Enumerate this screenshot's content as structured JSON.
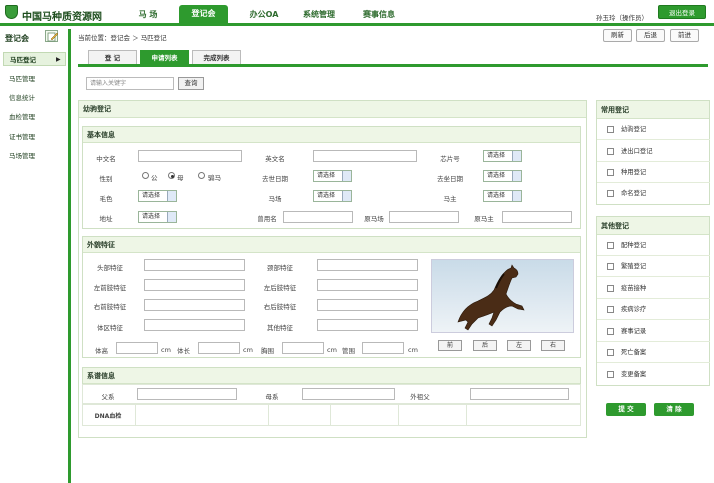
{
  "header": {
    "app_title": "中国马种质资源网",
    "nav": [
      "马 场",
      "登记会",
      "办公OA",
      "系统管理",
      "赛事信息"
    ],
    "user": "孙玉玲（操作员）",
    "logout": "退出登录"
  },
  "sidebar": {
    "title": "登记会",
    "items": [
      {
        "label": "马匹登记"
      },
      {
        "label": "马匹管理"
      },
      {
        "label": "信息统计"
      },
      {
        "label": "血检管理"
      },
      {
        "label": "证书管理"
      },
      {
        "label": "马场管理"
      }
    ]
  },
  "breadcrumb": "当前位置：登记会 ＞ 马匹登记",
  "toolbar": {
    "refresh": "刷新",
    "back": "后退",
    "forward": "前进"
  },
  "tabs": [
    "登 记",
    "申请列表",
    "完成列表"
  ],
  "search": {
    "placeholder": "请输入关键字",
    "button": "查询"
  },
  "form": {
    "title": "幼驹登记",
    "basic": {
      "title": "基本信息",
      "cn_name": "中文名",
      "en_name": "英文名",
      "chip": "芯片号",
      "gender": "性别",
      "gender_options": [
        "公",
        "母",
        "骟马"
      ],
      "death_date": "去世日期",
      "dereg_date": "去坐日期",
      "coat": "毛色",
      "farm": "马场",
      "owner": "马主",
      "address": "地址",
      "former_name": "曾用名",
      "former_farm": "原马场",
      "former_owner": "原马主",
      "select_placeholder": "请选择"
    },
    "appearance": {
      "title": "外貌特征",
      "head": "头部特征",
      "neck": "颈部特征",
      "lf_leg": "左前肢特征",
      "lr_leg": "左后肢特征",
      "rf_leg": "右前肢特征",
      "rr_leg": "右后肢特征",
      "body": "体区特征",
      "other": "其他特征",
      "height": "体高",
      "length": "体长",
      "chest": "胸围",
      "cannon": "管围",
      "unit": "cm",
      "views": [
        "前",
        "后",
        "左",
        "右"
      ]
    },
    "pedigree": {
      "title": "系谱信息",
      "sire": "父系",
      "dam": "母系",
      "grandsire": "外祖父",
      "dna": "DNA血检"
    }
  },
  "right_panel": {
    "common_title": "常用登记",
    "common": [
      "幼驹登记",
      "进出口登记",
      "种用登记",
      "命名登记"
    ],
    "other_title": "其他登记",
    "other": [
      "配种登记",
      "繁殖登记",
      "疫苗接种",
      "疾病诊疗",
      "赛事记录",
      "死亡备案",
      "变更备案"
    ],
    "submit": "提 交",
    "clear": "清 除"
  }
}
